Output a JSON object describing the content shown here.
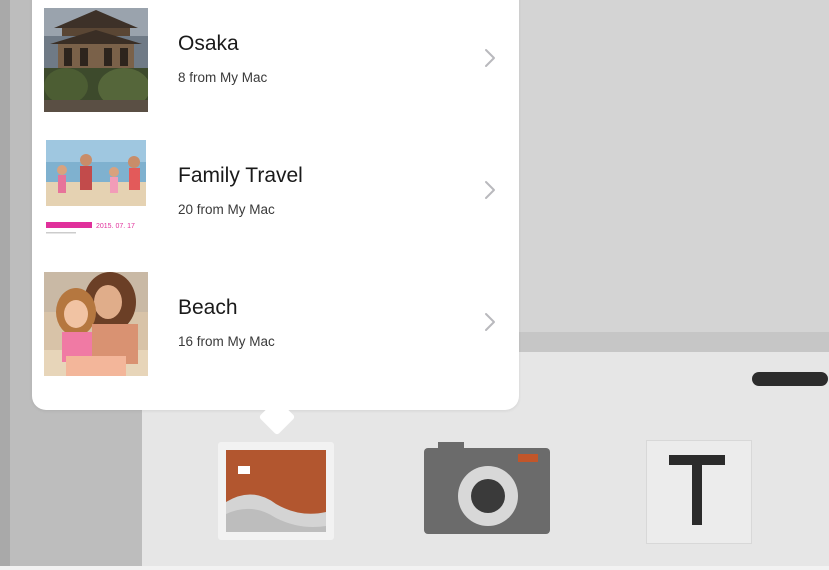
{
  "albums": [
    {
      "title": "Osaka",
      "subtitle": "8 from My Mac",
      "thumbnail": "osaka-temple-photo"
    },
    {
      "title": "Family Travel",
      "subtitle": "20 from My Mac",
      "thumbnail": "family-beach-photo"
    },
    {
      "title": "Beach",
      "subtitle": "16 from My Mac",
      "thumbnail": "mother-daughter-photo"
    }
  ],
  "toolbar": {
    "photos_icon": "photos-icon",
    "camera_icon": "camera-icon",
    "text_icon": "text-icon"
  },
  "colors": {
    "photos_accent": "#b2562f",
    "camera_body": "#6b6b6b",
    "camera_indicator": "#c2562a",
    "popover_bg": "#ffffff"
  }
}
